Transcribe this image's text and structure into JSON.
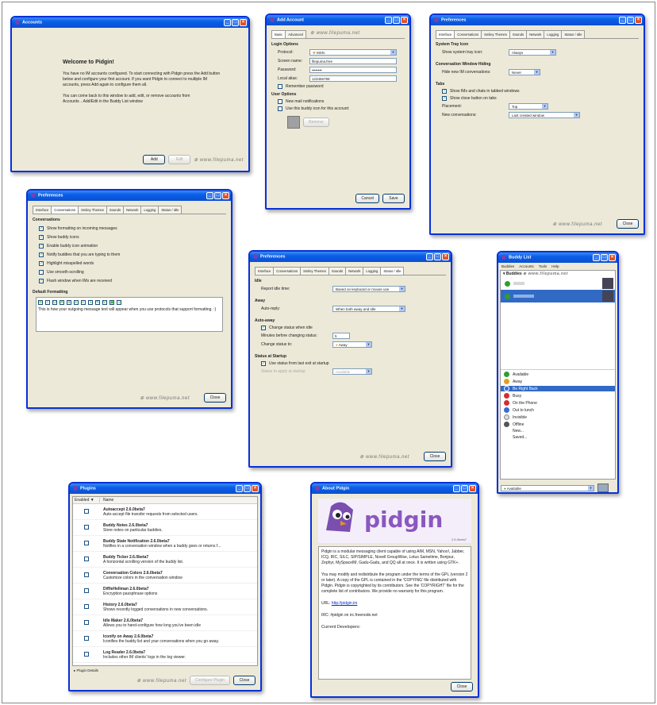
{
  "watermark": "www.filepuma.net",
  "w1": {
    "title": "Accounts",
    "welcome": "Welcome to Pidgin!",
    "para1": "You have no IM accounts configured. To start connecting with Pidgin press the Add button below and configure your first account. If you want Pidgin to connect to multiple IM accounts, press Add again to configure them all.",
    "para2": "You can come back to this window to add, edit, or remove accounts from Accounts→Add/Edit in the Buddy List window",
    "add_label": "Add",
    "edit_label": "Edit"
  },
  "w2": {
    "title": "Add Account",
    "tabs": [
      "Basic",
      "Advanced"
    ],
    "login_options": "Login Options",
    "protocol_label": "Protocol:",
    "protocol_value": "MSN",
    "screen_name_label": "Screen name:",
    "screen_name_value": "filepuma.free",
    "password_label": "Password:",
    "password_value": "••••••••",
    "local_alias_label": "Local alias:",
    "local_alias_value": "123456789",
    "remember": "Remember password",
    "user_options": "User Options",
    "new_mail": "New mail notifications",
    "use_icon": "Use this buddy icon for this account:",
    "remove_label": "Remove",
    "cancel_label": "Cancel",
    "save_label": "Save"
  },
  "w3": {
    "title": "Preferences",
    "tabs": [
      "Interface",
      "Conversations",
      "Smiley Themes",
      "Sounds",
      "Network",
      "Logging",
      "Status / Idle"
    ],
    "system_tray": "System Tray Icon",
    "show_tray_label": "Show system tray icon:",
    "show_tray_value": "Always",
    "conv_hiding": "Conversation Window Hiding",
    "hide_new_label": "Hide new IM conversations:",
    "hide_new_value": "Never",
    "tabs_h": "Tabs",
    "show_ims": "Show IMs and chats in tabbed windows",
    "show_close": "Show close button on tabs",
    "placement_label": "Placement:",
    "placement_value": "Top",
    "new_conv_label": "New conversations:",
    "new_conv_value": "Last created window",
    "close_label": "Close"
  },
  "w4": {
    "title": "Preferences",
    "tabs": [
      "Interface",
      "Conversations",
      "Smiley Themes",
      "Sounds",
      "Network",
      "Logging",
      "Status / Idle"
    ],
    "conversations_h": "Conversations",
    "opts": [
      "Show formatting on incoming messages",
      "Show buddy icons",
      "Enable buddy icon animation",
      "Notify buddies that you are typing to them",
      "Highlight misspelled words",
      "Use smooth-scrolling",
      "Flash window when IMs are received"
    ],
    "default_fmt": "Default Formatting",
    "fmt_preview": "This is how your outgoing message text will appear when you use protocols that support formatting. :)",
    "close_label": "Close"
  },
  "w5": {
    "title": "Preferences",
    "tabs": [
      "Interface",
      "Conversations",
      "Smiley Themes",
      "Sounds",
      "Network",
      "Logging",
      "Status / Idle"
    ],
    "idle_h": "Idle",
    "report_idle_label": "Report idle time:",
    "report_idle_value": "Based on keyboard or mouse use",
    "away_h": "Away",
    "auto_reply_label": "Auto-reply:",
    "auto_reply_value": "When both away and idle",
    "auto_away_h": "Auto-away",
    "change_status": "Change status when idle",
    "minutes_label": "Minutes before changing status:",
    "minutes_value": "5",
    "change_to_label": "Change status to:",
    "change_to_value": "Away",
    "startup_h": "Status at Startup",
    "use_last": "Use status from last exit at startup",
    "status_apply_label": "Status to apply at startup:",
    "status_apply_value": "Available",
    "close_label": "Close"
  },
  "w6": {
    "title": "Buddy List",
    "menu": [
      "Buddies",
      "Accounts",
      "Tools",
      "Help"
    ],
    "group_name": "Buddies",
    "statuses": [
      "Available",
      "Away",
      "Be Right Back",
      "Busy",
      "On the Phone",
      "Out to lunch",
      "Invisible",
      "Offline",
      "New...",
      "Saved..."
    ],
    "status_colors": [
      "#2f9e2f",
      "#e0a020",
      "#3a6ad4",
      "#d03030",
      "#d03030",
      "#3a6ad4",
      "#888888",
      "#555555"
    ],
    "current_status": "Available"
  },
  "w7": {
    "title": "Plugins",
    "col_enabled": "Enabled ▼",
    "col_name": "Name",
    "plugins": [
      {
        "name": "Autoaccept 2.6.0beta7",
        "desc": "Auto-accept file transfer requests from selected users."
      },
      {
        "name": "Buddy Notes 2.6.0beta7",
        "desc": "Store notes on particular buddies."
      },
      {
        "name": "Buddy State Notification 2.6.0beta7",
        "desc": "Notifies in a conversation window when a buddy goes or returns f..."
      },
      {
        "name": "Buddy Ticker 2.6.0beta7",
        "desc": "A horizontal scrolling version of the buddy list."
      },
      {
        "name": "Conversation Colors 2.6.0beta7",
        "desc": "Customize colors in the conversation window"
      },
      {
        "name": "DiffieHellman 2.6.0beta7",
        "desc": "Encryption passphrase options"
      },
      {
        "name": "History 2.6.0beta7",
        "desc": "Shows recently logged conversations in new conversations."
      },
      {
        "name": "Idle Maker 2.6.0beta7",
        "desc": "Allows you to hand-configure how long you've been idle"
      },
      {
        "name": "Iconify on Away 2.6.0beta7",
        "desc": "Iconifies the buddy list and your conversations when you go away."
      },
      {
        "name": "Log Reader 2.6.0beta7",
        "desc": "Includes other IM clients' logs in the log viewer."
      }
    ],
    "plugin_details": "Plugin Details",
    "configure_label": "Configure Plugin",
    "close_label": "Close"
  },
  "w8": {
    "title": "About Pidgin",
    "logo_text": "pidgin",
    "version": "2.6.0beta7",
    "p1": "Pidgin is a modular messaging client capable of using AIM, MSN, Yahoo!, Jabber, ICQ, IRC, SILC, SIP/SIMPLE, Novell GroupWise, Lotus Sametime, Bonjour, Zephyr, MySpaceIM, Gadu-Gadu, and QQ all at once. It is written using GTK+.",
    "p2": "You may modify and redistribute the program under the terms of the GPL (version 2 or later). A copy of the GPL is contained in the 'COPYING' file distributed with Pidgin. Pidgin is copyrighted by its contributors. See the 'COPYRIGHT' file for the complete list of contributors. We provide no warranty for this program.",
    "url_label": "URL:",
    "url": "http://pidgin.im",
    "irc": "IRC: #pidgin on irc.freenode.net",
    "current_dev": "Current Developers:",
    "close_label": "Close"
  }
}
